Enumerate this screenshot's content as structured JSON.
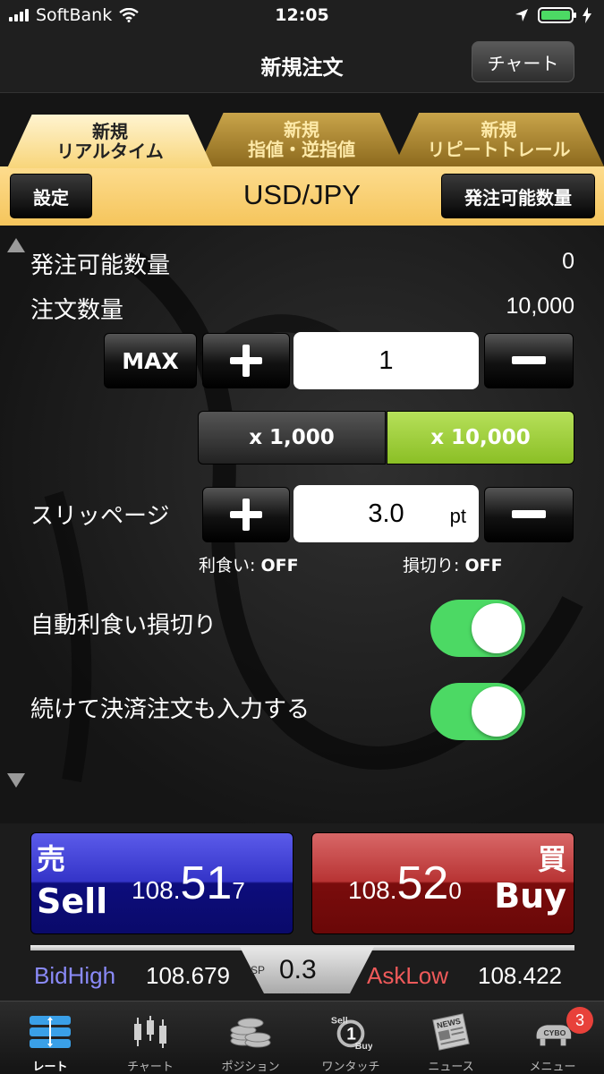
{
  "status_bar": {
    "carrier": "SoftBank",
    "time": "12:05"
  },
  "nav": {
    "title": "新規注文",
    "chart_button": "チャート"
  },
  "tabs": [
    {
      "line1": "新規",
      "line2": "リアルタイム"
    },
    {
      "line1": "新規",
      "line2": "指値・逆指値"
    },
    {
      "line1": "新規",
      "line2": "リピートトレール"
    }
  ],
  "symbol_bar": {
    "settings_label": "設定",
    "symbol": "USD/JPY",
    "available_label": "発注可能数量"
  },
  "order": {
    "available_qty_label": "発注可能数量",
    "available_qty_value": "0",
    "order_qty_label": "注文数量",
    "order_qty_value": "10,000",
    "max_label": "MAX",
    "qty_input": "1",
    "multiplier_1": "x 1,000",
    "multiplier_2": "x 10,000",
    "slippage_label": "スリッページ",
    "slippage_value": "3.0",
    "slippage_unit": "pt",
    "take_profit_label": "利食い:",
    "take_profit_value": "OFF",
    "stop_loss_label": "損切り:",
    "stop_loss_value": "OFF",
    "auto_tp_sl_label": "自動利食い損切り",
    "continue_settlement_label": "続けて決済注文も入力する"
  },
  "trade": {
    "sell_kanji": "売",
    "sell_word": "Sell",
    "sell_price_prefix": "108.",
    "sell_price_big": "51",
    "sell_price_last": "7",
    "buy_kanji": "買",
    "buy_word": "Buy",
    "buy_price_prefix": "108.",
    "buy_price_big": "52",
    "buy_price_last": "0",
    "sp_label": "SP",
    "sp_value": "0.3",
    "bid_high_label": "BidHigh",
    "bid_high_value": "108.679",
    "ask_low_label": "AskLow",
    "ask_low_value": "108.422"
  },
  "tab_bar": [
    {
      "label": "レート",
      "icon": "rate-icon"
    },
    {
      "label": "チャート",
      "icon": "candlestick-icon"
    },
    {
      "label": "ポジション",
      "icon": "coins-icon"
    },
    {
      "label": "ワンタッチ",
      "icon": "one-touch-icon"
    },
    {
      "label": "ニュース",
      "icon": "newspaper-icon"
    },
    {
      "label": "メニュー",
      "icon": "menu-icon"
    }
  ],
  "menu_badge": "3",
  "one_touch_icon_text": {
    "sell": "Sell",
    "one": "1",
    "buy": "Buy"
  },
  "news_icon_text": "NEWS",
  "menu_icon_text": "CYBO",
  "colors": {
    "sell_blue": "#1a1aa8",
    "buy_red": "#9b1a1a",
    "toggle_green": "#4cd964",
    "multiplier_active": "#9ccc3a",
    "tab_gold": "#f8d57a"
  }
}
